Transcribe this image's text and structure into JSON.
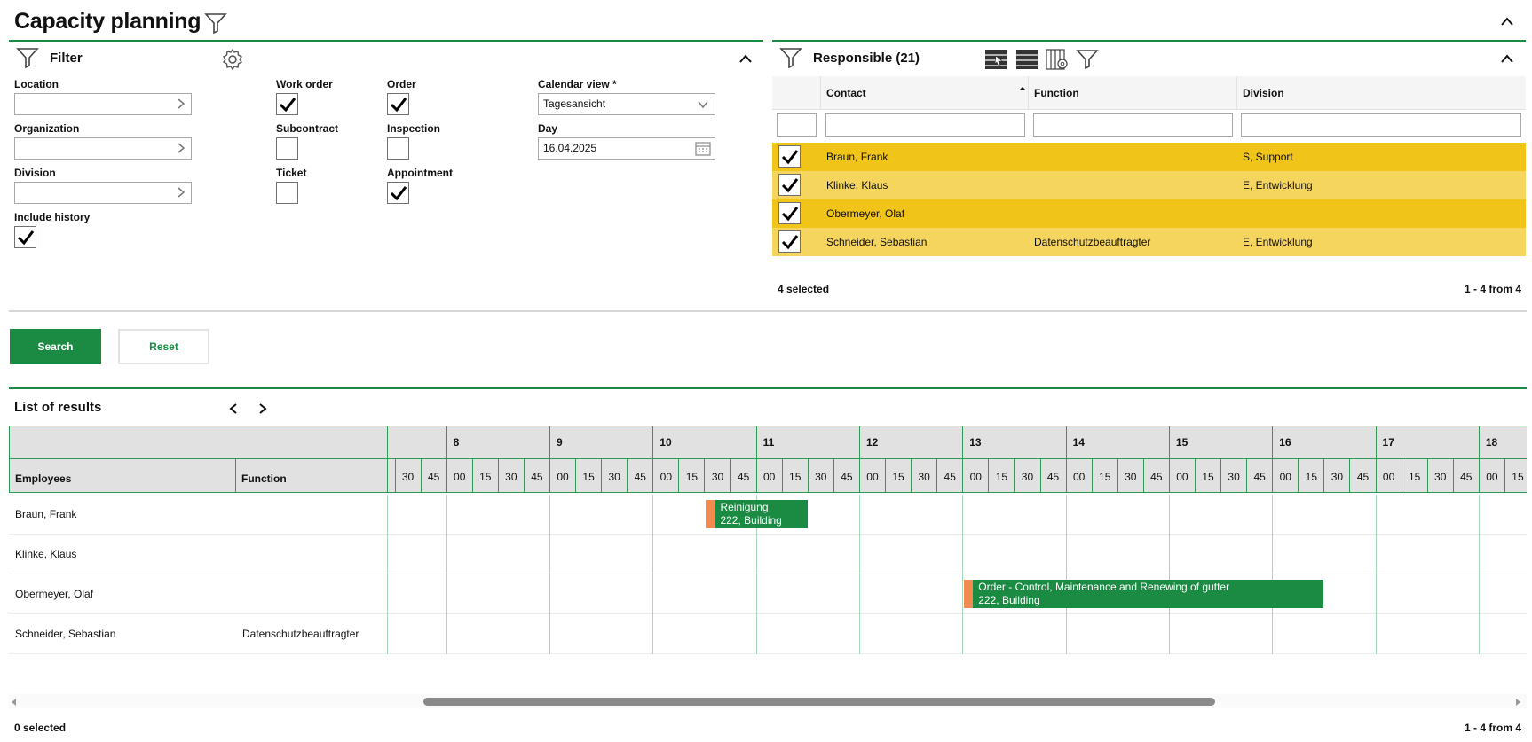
{
  "page": {
    "title": "Capacity planning"
  },
  "filter": {
    "title": "Filter",
    "location_label": "Location",
    "organization_label": "Organization",
    "division_label": "Division",
    "include_history_label": "Include history",
    "work_order_label": "Work order",
    "subcontract_label": "Subcontract",
    "ticket_label": "Ticket",
    "order_label": "Order",
    "inspection_label": "Inspection",
    "appointment_label": "Appointment",
    "calendar_view_label": "Calendar view *",
    "calendar_view_value": "Tagesansicht",
    "day_label": "Day",
    "day_value": "16.04.2025",
    "checked": {
      "include_history": true,
      "work_order": true,
      "subcontract": false,
      "ticket": false,
      "order": true,
      "inspection": false,
      "appointment": true
    }
  },
  "responsible": {
    "title": "Responsible (21)",
    "columns": {
      "contact": "Contact",
      "function": "Function",
      "division": "Division"
    },
    "rows": [
      {
        "contact": "Braun, Frank",
        "function": "",
        "division": "S, Support",
        "checked": true
      },
      {
        "contact": "Klinke, Klaus",
        "function": "",
        "division": "E, Entwicklung",
        "checked": true
      },
      {
        "contact": "Obermeyer, Olaf",
        "function": "",
        "division": "",
        "checked": true
      },
      {
        "contact": "Schneider, Sebastian",
        "function": "Datenschutzbeauftragter",
        "division": "E, Entwicklung",
        "checked": true
      }
    ],
    "selected_text": "4 selected",
    "pager_text": "1 - 4 from 4",
    "row_colors": [
      "#f0c419",
      "#f5d55e"
    ]
  },
  "actions": {
    "search_label": "Search",
    "reset_label": "Reset"
  },
  "results": {
    "title": "List of results",
    "employees_header": "Employees",
    "function_header": "Function",
    "hours": [
      "8",
      "9",
      "10",
      "11",
      "12",
      "13",
      "14",
      "15",
      "16",
      "17",
      "18"
    ],
    "quarter_labels": [
      "30",
      "45",
      "00",
      "15",
      "30",
      "45",
      "00",
      "15",
      "30",
      "45",
      "00",
      "15",
      "30",
      "45",
      "00",
      "15",
      "30",
      "45",
      "00",
      "15",
      "30",
      "45",
      "00",
      "15",
      "30",
      "45",
      "00",
      "15",
      "30",
      "45",
      "00",
      "15",
      "30",
      "45",
      "00",
      "15",
      "30",
      "45",
      "00",
      "15",
      "30",
      "45",
      "00",
      "15"
    ],
    "rows": [
      {
        "employee": "Braun, Frank",
        "function": ""
      },
      {
        "employee": "Klinke, Klaus",
        "function": ""
      },
      {
        "employee": "Obermeyer, Olaf",
        "function": ""
      },
      {
        "employee": "Schneider, Sebastian",
        "function": "Datenschutzbeauftragter"
      }
    ],
    "appointments": [
      {
        "row": 0,
        "start": "10:30",
        "end": "11:30",
        "line1": "Reinigung",
        "line2": "222, Building"
      },
      {
        "row": 2,
        "start": "13:00",
        "end": "16:30",
        "line1": "Order - Control, Maintenance and Renewing of gutter",
        "line2": "222, Building"
      }
    ],
    "selected_text": "0 selected",
    "pager_text": "1 - 4 from 4"
  },
  "colors": {
    "accent_green": "#1b8a43",
    "appointment_accent": "#f28b50"
  }
}
